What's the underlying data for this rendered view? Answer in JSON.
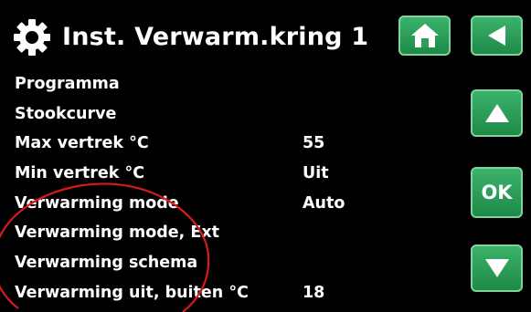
{
  "header": {
    "title": "Inst. Verwarm.kring 1",
    "icon": "gear-icon"
  },
  "nav": {
    "home_icon": "home-icon",
    "back_icon": "back-arrow-icon",
    "up_icon": "arrow-up-icon",
    "ok_label": "OK",
    "down_icon": "arrow-down-icon"
  },
  "menu": {
    "items": [
      {
        "label": "Programma",
        "value": ""
      },
      {
        "label": "Stookcurve",
        "value": ""
      },
      {
        "label": "Max vertrek °C",
        "value": "55"
      },
      {
        "label": "Min vertrek °C",
        "value": "Uit"
      },
      {
        "label": "Verwarming mode",
        "value": "Auto"
      },
      {
        "label": "Verwarming mode, Ext",
        "value": ""
      },
      {
        "label": "Verwarming schema",
        "value": ""
      },
      {
        "label": "Verwarming uit, buiten °C",
        "value": "18"
      }
    ]
  },
  "colors": {
    "background": "#000000",
    "button_green": "#2a9e5a",
    "annotation_red": "#d81a1a",
    "text": "#ffffff"
  }
}
